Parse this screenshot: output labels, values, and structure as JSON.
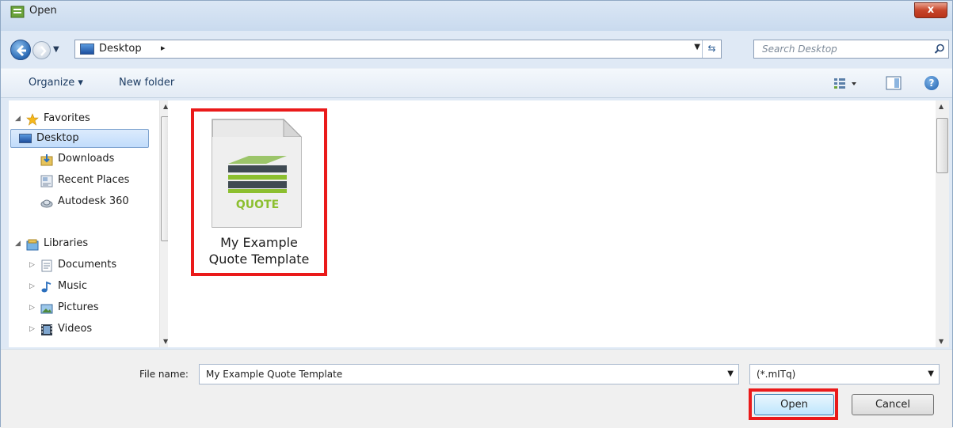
{
  "window": {
    "title": "Open",
    "close_label": "x"
  },
  "address_bar": {
    "location": "Desktop",
    "separator": "▸"
  },
  "search": {
    "placeholder": "Search Desktop"
  },
  "toolbar": {
    "organize": "Organize ▾",
    "new_folder": "New folder",
    "help": "?"
  },
  "navigation": {
    "favorites": {
      "label": "Favorites",
      "items": [
        "Desktop",
        "Downloads",
        "Recent Places",
        "Autodesk 360"
      ]
    },
    "libraries": {
      "label": "Libraries",
      "items": [
        "Documents",
        "Music",
        "Pictures",
        "Videos"
      ]
    }
  },
  "files": [
    {
      "name": "My Example Quote Template",
      "icon_text": "QUOTE"
    }
  ],
  "footer": {
    "file_name_label": "File name:",
    "file_name_value": "My Example Quote Template",
    "file_type_value": "(*.mITq)",
    "open_label": "Open",
    "cancel_label": "Cancel"
  },
  "colors": {
    "highlight": "#ea1a1a",
    "selection": "#c1dcfb",
    "window_frame": "#dfe9f5",
    "brand_green": "#8cbf2f"
  }
}
